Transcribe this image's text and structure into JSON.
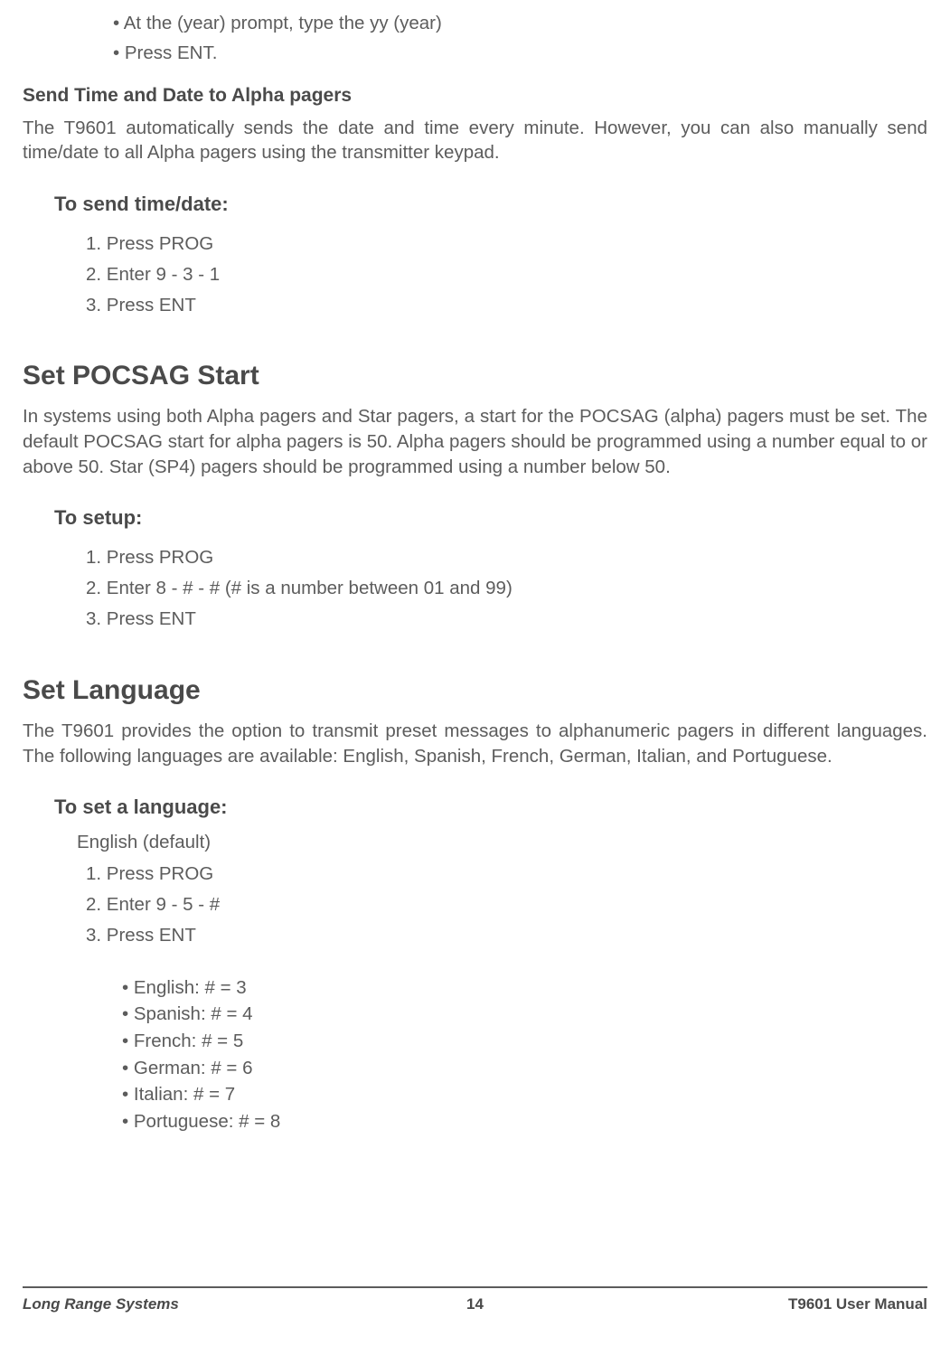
{
  "top_bullets": {
    "b1": "At the (year) prompt, type the yy (year)",
    "b2": "Press ENT."
  },
  "send_td": {
    "heading": "Send Time and Date to Alpha pagers",
    "body": "The T9601 automatically sends the date and time every minute.  However, you can also manually send time/date to all Alpha pagers using the transmitter keypad.",
    "step_heading": "To send time/date:",
    "steps": {
      "s1": "1. Press PROG",
      "s2": "2. Enter 9 - 3 - 1",
      "s3": "3. Press ENT"
    }
  },
  "pocsag": {
    "title": "Set POCSAG Start",
    "body": "In systems using both Alpha pagers and Star pagers, a start for the POCSAG (alpha) pagers must be set. The default POCSAG start for alpha pagers is 50. Alpha pagers should be programmed using a number equal to or above 50. Star (SP4) pagers should be programmed using a number below 50.",
    "step_heading": "To setup:",
    "steps": {
      "s1": "1. Press PROG",
      "s2": "2. Enter 8 - # - # (# is a number between 01 and 99)",
      "s3": "3. Press ENT"
    }
  },
  "language": {
    "title": "Set Language",
    "body": "The T9601 provides the option to transmit preset messages to alphanumeric pagers in different languages. The following languages are available: English, Spanish, French, German, Italian, and Portuguese.",
    "step_heading": "To set a language:",
    "default_note": "English (default)",
    "steps": {
      "s1": "1. Press PROG",
      "s2": "2. Enter 9 - 5 - #",
      "s3": "3. Press ENT"
    },
    "codes": {
      "english": "English: # = 3",
      "spanish": "Spanish: # = 4",
      "french": "French: # = 5",
      "german": "German: # = 6",
      "italian": "Italian: # = 7",
      "portuguese": "Portuguese: # = 8"
    }
  },
  "footer": {
    "left": "Long Range Systems",
    "center": "14",
    "right": "T9601 User Manual"
  }
}
